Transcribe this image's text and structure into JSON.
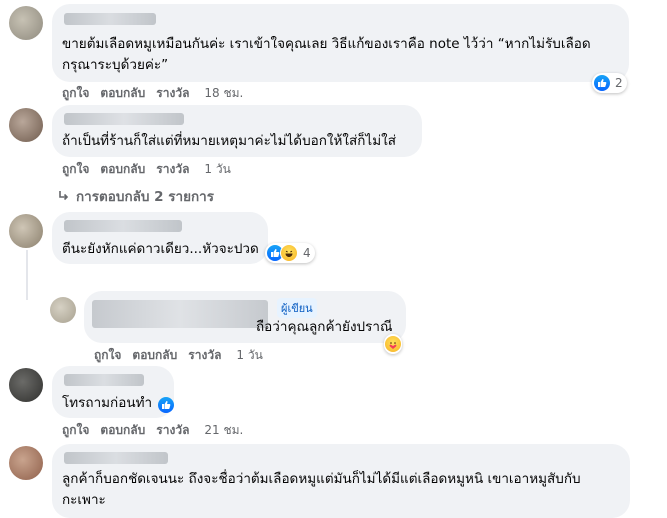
{
  "comments": [
    {
      "text_lines": [
        "ขายต้มเลือดหมูเหมือนกันค่ะ เราเข้าใจคุณเลย วิธีแก้ของเราคือ note ไว้ว่า “หากไม่รับเลือด",
        "กรุณาระบุด้วยค่ะ”"
      ],
      "actions": {
        "like": "ถูกใจ",
        "reply": "ตอบกลับ",
        "reward": "รางวัล"
      },
      "time": "18 ชม.",
      "reaction_count": "2",
      "reactions": [
        "like-icon"
      ]
    },
    {
      "text_lines": [
        "ถ้าเป็นที่ร้านก็ใส่แต่ที่หมายเหตุมาค่ะไม่ได้บอกให้ใส่ก็ไม่ใส่"
      ],
      "actions": {
        "like": "ถูกใจ",
        "reply": "ตอบกลับ",
        "reward": "รางวัล"
      },
      "time": "1 วัน",
      "replies_link": "การตอบกลับ 2 รายการ"
    },
    {
      "text_lines": [
        "ตีนะยังหักแค่ดาวเดียว...หัวจะปวด"
      ],
      "reaction_count": "4",
      "reactions": [
        "like-icon",
        "haha-icon"
      ]
    },
    {
      "badge": "ผู้เขียน",
      "text_lines": [
        "ถือว่าคุณลูกค้ายังปราณี"
      ],
      "actions": {
        "like": "ถูกใจ",
        "reply": "ตอบกลับ",
        "reward": "รางวัล"
      },
      "time": "1 วัน",
      "reactions": [
        "care-icon"
      ]
    },
    {
      "text_lines": [
        "โทรถามก่อนทำ"
      ],
      "actions": {
        "like": "ถูกใจ",
        "reply": "ตอบกลับ",
        "reward": "รางวัล"
      },
      "time": "21 ชม.",
      "reactions": [
        "like-icon"
      ]
    },
    {
      "text_lines": [
        "ลูกค้าก็บอกชัดเจนนะ ถึงจะชื่อว่าต้มเลือดหมูแต่มันก็ไม่ได้มีแต่เลือดหมูหนิ เขาเอาหมูสับกับ",
        "กะเพาะ"
      ]
    }
  ],
  "colors": {
    "accent": "#0866ff",
    "bubble": "#f0f2f5",
    "meta": "#65676b"
  }
}
